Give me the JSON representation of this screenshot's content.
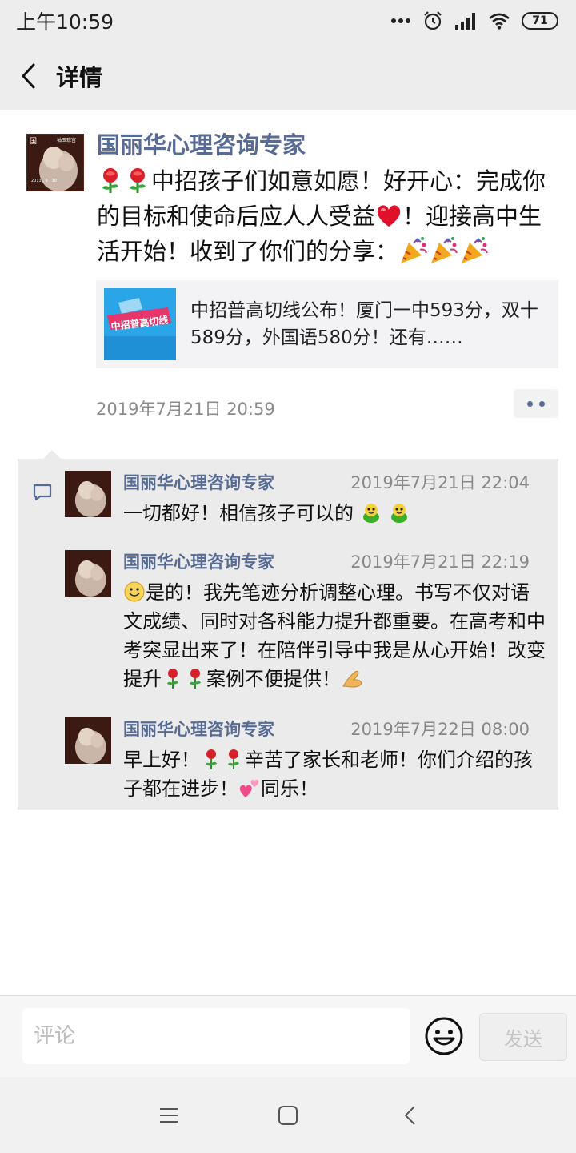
{
  "status_bar": {
    "time": "上午10:59",
    "battery": "71",
    "icons": [
      "more-icon",
      "alarm-icon",
      "signal-icon",
      "wifi-icon",
      "battery-icon"
    ]
  },
  "nav": {
    "title": "详情"
  },
  "post": {
    "author": "国丽华心理咨询专家",
    "text_parts": [
      "中招孩子们如意如愿！好开心：完成你的目标和使命后应人人受益",
      "！迎接高中生活开始！收到了你们的分享："
    ],
    "link_card": {
      "thumb_text": "中招普高切线",
      "title": "中招普高切线公布！厦门一中593分，双十589分，外国语580分！还有……"
    },
    "timestamp": "2019年7月21日 20:59"
  },
  "comments": [
    {
      "author": "国丽华心理咨询专家",
      "time": "2019年7月21日 22:04",
      "text": "一切都好！相信孩子可以的"
    },
    {
      "author": "国丽华心理咨询专家",
      "time": "2019年7月21日 22:19",
      "text_a": "是的！我先笔迹分析调整心理。书写不仅对语文成绩、同时对各科能力提升都重要。在高考和中考突显出来了！在陪伴引导中我是从心开始！改变提升",
      "text_b": "案例不便提供！"
    },
    {
      "author": "国丽华心理咨询专家",
      "time": "2019年7月22日 08:00",
      "text_a": "早上好！",
      "text_b": "辛苦了家长和老师！你们介绍的孩子都在进步！",
      "text_c": "同乐！"
    }
  ],
  "avatar_text": {
    "top": "国",
    "sign": "袖玉琮宫",
    "caption": "2013 . 9 . 30"
  },
  "input_bar": {
    "placeholder": "评论",
    "send_label": "发送"
  },
  "colors": {
    "link_blue": "#576b95",
    "bar_gray": "#ededed",
    "comment_bg": "#ebebeb"
  }
}
